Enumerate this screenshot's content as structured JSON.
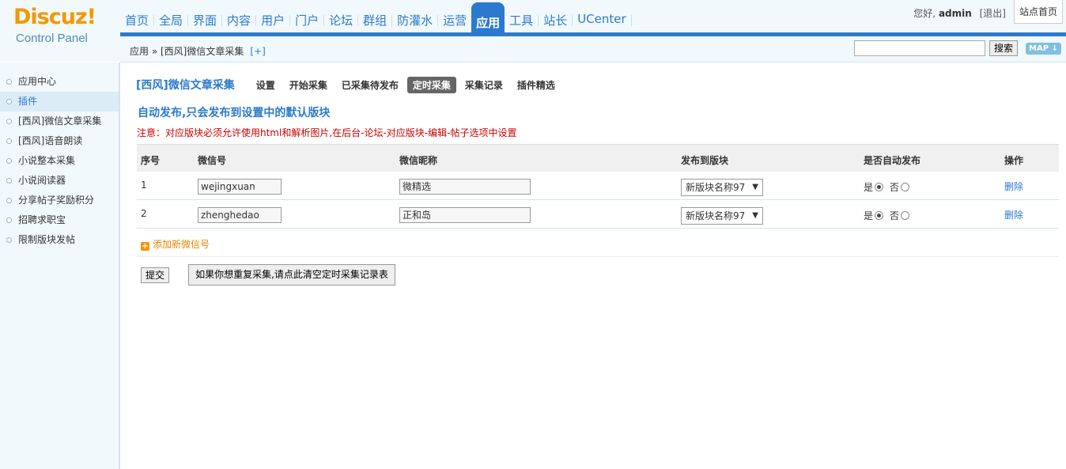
{
  "logo": {
    "brand": "Discuz!",
    "subtitle": "Control Panel"
  },
  "topnav": [
    "首页",
    "全局",
    "界面",
    "内容",
    "用户",
    "门户",
    "论坛",
    "群组",
    "防灌水",
    "运营",
    "应用",
    "工具",
    "站长",
    "UCenter"
  ],
  "topnav_active": "应用",
  "user": {
    "greeting": "您好,",
    "name": "admin",
    "logout": "[退出]",
    "site_home": "站点首页"
  },
  "breadcrumb": {
    "path": "应用 » [西风]微信文章采集",
    "plus": "[+]"
  },
  "search": {
    "value": "",
    "button": "搜索",
    "map": "MAP"
  },
  "sidebar": {
    "items": [
      "应用中心",
      "插件",
      "[西风]微信文章采集",
      "[西风]语音朗读",
      "小说整本采集",
      "小说阅读器",
      "分享帖子奖励积分",
      "招聘求职宝",
      "限制版块发帖"
    ],
    "active": "插件"
  },
  "plugin": {
    "title": "[西风]微信文章采集",
    "tabs": [
      "设置",
      "开始采集",
      "已采集待发布",
      "定时采集",
      "采集记录",
      "插件精选"
    ],
    "active_tab": "定时采集"
  },
  "section_title": "自动发布,只会发布到设置中的默认版块",
  "notice": "注意：对应版块必须允许使用html和解析图片,在后台-论坛-对应版块-编辑-帖子选项中设置",
  "table": {
    "headers": [
      "序号",
      "微信号",
      "微信昵称",
      "发布到版块",
      "是否自动发布",
      "操作"
    ],
    "rows": [
      {
        "index": "1",
        "wechat_id": "wejingxuan",
        "nickname": "微精选",
        "forum": "新版块名称97",
        "yes": "是",
        "no": "否",
        "auto": "yes",
        "action": "删除"
      },
      {
        "index": "2",
        "wechat_id": "zhenghedao",
        "nickname": "正和岛",
        "forum": "新版块名称97",
        "yes": "是",
        "no": "否",
        "auto": "yes",
        "action": "删除"
      }
    ]
  },
  "add_link": "添加新微信号",
  "buttons": {
    "submit": "提交",
    "clear": "如果你想重复采集,请点此清空定时采集记录表"
  }
}
